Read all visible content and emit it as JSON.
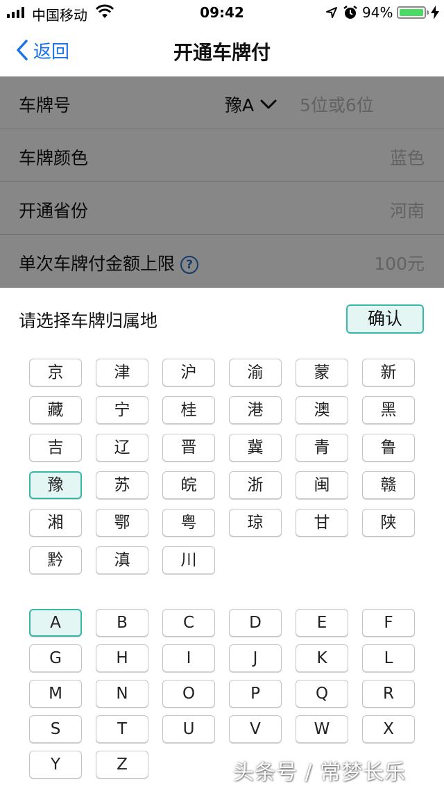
{
  "status_bar": {
    "carrier": "中国移动",
    "time": "09:42",
    "battery_percent": "94%"
  },
  "nav": {
    "back_label": "返回",
    "title": "开通车牌付"
  },
  "form": {
    "plate_label": "车牌号",
    "plate_province": "豫A",
    "plate_placeholder": "5位或6位",
    "color_label": "车牌颜色",
    "color_value": "蓝色",
    "province_label": "开通省份",
    "province_value": "河南",
    "limit_label": "单次车牌付金额上限",
    "limit_value": "100元",
    "help_glyph": "?"
  },
  "picker": {
    "title": "请选择车牌归属地",
    "confirm_label": "确认",
    "provinces": [
      "京",
      "津",
      "沪",
      "渝",
      "蒙",
      "新",
      "藏",
      "宁",
      "桂",
      "港",
      "澳",
      "黑",
      "吉",
      "辽",
      "晋",
      "冀",
      "青",
      "鲁",
      "豫",
      "苏",
      "皖",
      "浙",
      "闽",
      "赣",
      "湘",
      "鄂",
      "粤",
      "琼",
      "甘",
      "陕",
      "黔",
      "滇",
      "川"
    ],
    "selected_province": "豫",
    "letters": [
      "A",
      "B",
      "C",
      "D",
      "E",
      "F",
      "G",
      "H",
      "I",
      "J",
      "K",
      "L",
      "M",
      "N",
      "O",
      "P",
      "Q",
      "R",
      "S",
      "T",
      "U",
      "V",
      "W",
      "X",
      "Y",
      "Z"
    ],
    "selected_letter": "A"
  },
  "watermark": "头条号 / 常梦长乐",
  "colors": {
    "accent": "#36b8a8",
    "accent_bg": "#e3f6f3",
    "link": "#1a73e8",
    "battery": "#4cd964"
  }
}
